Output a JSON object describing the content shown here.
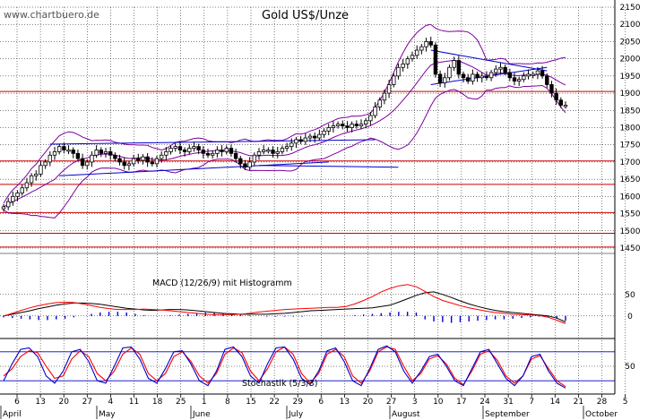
{
  "watermark": "www.chartbuero.de",
  "colors": {
    "candle": "#000000",
    "bollinger": "#8000a0",
    "trendline": "#0000cc",
    "support": "#cc0000",
    "macd": "#000000",
    "signal": "#ff0000",
    "histogram": "#0000cc",
    "stoch_k": "#0000cc",
    "stoch_d": "#ff0000",
    "grid": "#000000",
    "panel_border": "#000000"
  },
  "chart_data": [
    {
      "type": "candlestick",
      "title": "Gold US$/Unze",
      "ylim": [
        1440,
        2160
      ],
      "ytick_labels": [
        "1450",
        "1500",
        "1550",
        "1600",
        "1650",
        "1700",
        "1750",
        "1800",
        "1850",
        "1900",
        "1950",
        "2000",
        "2050",
        "2100",
        "2150"
      ],
      "x_date_labels": [
        "6",
        "13",
        "20",
        "27",
        "4",
        "11",
        "18",
        "25",
        "1",
        "8",
        "15",
        "22",
        "29",
        "6",
        "13",
        "20",
        "27",
        "3",
        "10",
        "17",
        "24",
        "31",
        "7",
        "14",
        "21",
        "28",
        "5"
      ],
      "month_labels": [
        "April",
        "May",
        "June",
        "July",
        "August",
        "September",
        "October"
      ],
      "horizontal_support_lines": [
        1453,
        1493,
        1553,
        1635,
        1703,
        1905
      ],
      "overlays": [
        "bollinger bands",
        "trend channels"
      ],
      "approx_close": [
        1570,
        1585,
        1600,
        1610,
        1625,
        1640,
        1660,
        1665,
        1690,
        1700,
        1720,
        1730,
        1745,
        1735,
        1735,
        1725,
        1710,
        1690,
        1700,
        1720,
        1735,
        1725,
        1730,
        1720,
        1710,
        1700,
        1690,
        1695,
        1710,
        1705,
        1715,
        1700,
        1695,
        1710,
        1720,
        1730,
        1740,
        1745,
        1735,
        1730,
        1740,
        1745,
        1735,
        1725,
        1720,
        1725,
        1735,
        1730,
        1740,
        1725,
        1710,
        1695,
        1685,
        1700,
        1720,
        1730,
        1735,
        1735,
        1725,
        1730,
        1740,
        1745,
        1755,
        1765,
        1760,
        1770,
        1775,
        1770,
        1780,
        1790,
        1800,
        1805,
        1810,
        1805,
        1800,
        1810,
        1805,
        1810,
        1820,
        1835,
        1860,
        1880,
        1900,
        1925,
        1950,
        1975,
        1985,
        2000,
        2010,
        2025,
        2035,
        2050,
        2040,
        1955,
        1930,
        1945,
        1975,
        1995,
        1955,
        1945,
        1935,
        1955,
        1945,
        1950,
        1945,
        1960,
        1970,
        1975,
        1960,
        1945,
        1935,
        1940,
        1950,
        1955,
        1955,
        1965,
        1950,
        1925,
        1900,
        1880,
        1865,
        1865
      ]
    },
    {
      "type": "line",
      "title": "MACD (12/26/9) mit Histogramm",
      "ytick_labels": [
        "50",
        "0"
      ],
      "ylim": [
        -40,
        110
      ],
      "series": [
        {
          "name": "MACD",
          "values": [
            0,
            4,
            8,
            12,
            17,
            21,
            25,
            28,
            30,
            30,
            29,
            27,
            24,
            21,
            18,
            16,
            14,
            13,
            14,
            15,
            15,
            14,
            12,
            10,
            8,
            6,
            5,
            4,
            4,
            4,
            4,
            5,
            6,
            8,
            10,
            12,
            13,
            14,
            15,
            16,
            17,
            18,
            19,
            22,
            25,
            32,
            40,
            48,
            54,
            56,
            50,
            43,
            35,
            28,
            22,
            17,
            13,
            10,
            8,
            6,
            4,
            2,
            0,
            -5,
            -14
          ]
        },
        {
          "name": "Signal",
          "values": [
            0,
            6,
            13,
            19,
            24,
            28,
            31,
            32,
            31,
            28,
            24,
            20,
            17,
            15,
            15,
            15,
            16,
            15,
            14,
            12,
            10,
            8,
            6,
            4,
            3,
            3,
            3,
            4,
            6,
            9,
            11,
            13,
            15,
            16,
            17,
            18,
            19,
            20,
            20,
            22,
            28,
            36,
            45,
            56,
            64,
            70,
            73,
            68,
            57,
            45,
            36,
            30,
            24,
            19,
            15,
            11,
            8,
            6,
            4,
            3,
            2,
            1,
            -3,
            -10,
            -18
          ]
        },
        {
          "name": "Histogramm",
          "values": [
            -2,
            -3,
            -4,
            -5,
            -6,
            -6,
            -5,
            -4,
            -2,
            0,
            3,
            5,
            6,
            6,
            5,
            3,
            1,
            0,
            0,
            1,
            2,
            3,
            4,
            5,
            5,
            4,
            3,
            2,
            1,
            0,
            -1,
            -1,
            -1,
            -1,
            -1,
            0,
            0,
            0,
            0,
            0,
            1,
            2,
            3,
            4,
            5,
            6,
            6,
            5,
            -5,
            -8,
            -9,
            -10,
            -9,
            -8,
            -7,
            -6,
            -5,
            -5,
            -4,
            -3,
            -2,
            -1,
            -2,
            -4,
            -7
          ]
        }
      ]
    },
    {
      "type": "line",
      "title": "Stochastik (5/3/3)",
      "ytick_labels": [
        "50"
      ],
      "ylim": [
        0,
        100
      ],
      "series": [
        {
          "name": "%K",
          "values": [
            20,
            55,
            85,
            88,
            70,
            30,
            15,
            40,
            80,
            85,
            60,
            20,
            15,
            50,
            88,
            90,
            65,
            25,
            15,
            45,
            80,
            82,
            55,
            20,
            10,
            40,
            85,
            90,
            70,
            30,
            15,
            55,
            88,
            90,
            65,
            25,
            12,
            40,
            82,
            88,
            60,
            20,
            10,
            45,
            85,
            92,
            80,
            40,
            15,
            40,
            70,
            75,
            50,
            20,
            10,
            45,
            80,
            85,
            55,
            25,
            10,
            30,
            70,
            75,
            40,
            15,
            5
          ]
        },
        {
          "name": "%D",
          "values": [
            30,
            45,
            70,
            82,
            78,
            50,
            25,
            30,
            65,
            82,
            70,
            35,
            20,
            40,
            75,
            88,
            75,
            35,
            20,
            35,
            70,
            80,
            60,
            30,
            15,
            35,
            75,
            88,
            78,
            40,
            20,
            45,
            80,
            90,
            75,
            35,
            15,
            35,
            75,
            85,
            70,
            30,
            15,
            40,
            80,
            90,
            85,
            50,
            20,
            35,
            65,
            72,
            55,
            25,
            12,
            40,
            75,
            82,
            62,
            30,
            15,
            30,
            65,
            72,
            45,
            20,
            8
          ]
        }
      ]
    }
  ]
}
